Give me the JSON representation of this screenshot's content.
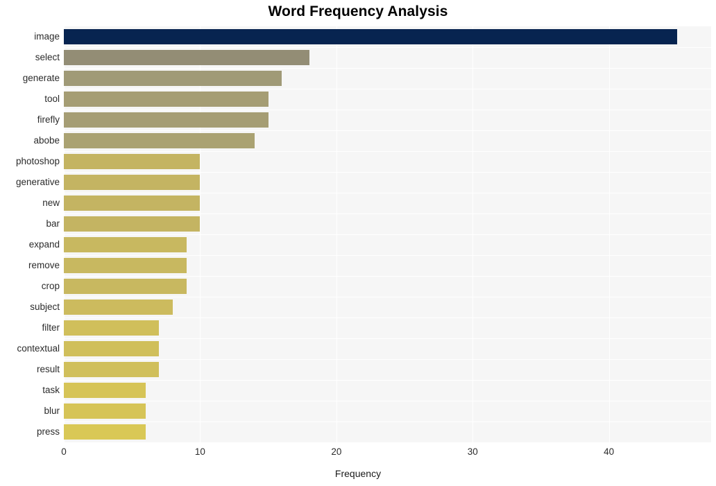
{
  "chart_data": {
    "type": "bar",
    "orientation": "horizontal",
    "title": "Word Frequency Analysis",
    "xlabel": "Frequency",
    "ylabel": "",
    "xlim": [
      0,
      47.5
    ],
    "ylim": [
      0,
      20
    ],
    "grid": true,
    "legend": false,
    "xticks": [
      0,
      10,
      20,
      30,
      40
    ],
    "xtick_labels": [
      "0",
      "10",
      "20",
      "30",
      "40"
    ],
    "categories": [
      "image",
      "select",
      "generate",
      "tool",
      "firefly",
      "abobe",
      "photoshop",
      "generative",
      "new",
      "bar",
      "expand",
      "remove",
      "crop",
      "subject",
      "filter",
      "contextual",
      "result",
      "task",
      "blur",
      "press"
    ],
    "values": [
      45,
      18,
      16,
      15,
      15,
      14,
      10,
      10,
      10,
      10,
      9,
      9,
      9,
      8,
      7,
      7,
      7,
      6,
      6,
      6
    ],
    "bar_colors": [
      "#072450",
      "#938d75",
      "#a09a77",
      "#a59d74",
      "#a59d74",
      "#aaa272",
      "#c4b462",
      "#c4b462",
      "#c4b462",
      "#c4b462",
      "#c8b860",
      "#c8b860",
      "#c8b860",
      "#ccbb5e",
      "#d0bf5b",
      "#d0bf5b",
      "#d0bf5b",
      "#d6c457",
      "#d6c457",
      "#d9c856"
    ],
    "plot_background": "#f6f6f6",
    "gridline_color": "#ffffff",
    "figure_background": "#ffffff",
    "text_color": "#2b2b2b"
  }
}
